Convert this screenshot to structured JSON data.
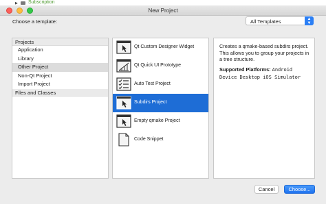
{
  "behind": {
    "label": "Subscription"
  },
  "window": {
    "title": "New Project"
  },
  "choose_label": "Choose a template:",
  "filter": {
    "selected": "All Templates"
  },
  "categories": {
    "projects_header": "Projects",
    "items": [
      "Application",
      "Library",
      "Other Project",
      "Non-Qt Project",
      "Import Project"
    ],
    "selected_index": 2,
    "files_header": "Files and Classes"
  },
  "templates": [
    {
      "label": "Qt Custom Designer Widget",
      "icon": "designer-widget-icon"
    },
    {
      "label": "Qt Quick UI Prototype",
      "icon": "qtquick-icon"
    },
    {
      "label": "Auto Test Project",
      "icon": "checklist-icon"
    },
    {
      "label": "Subdirs Project",
      "icon": "window-cursor-icon"
    },
    {
      "label": "Empty qmake Project",
      "icon": "window-cursor-icon"
    },
    {
      "label": "Code Snippet",
      "icon": "document-icon"
    }
  ],
  "selected_template_index": 3,
  "description": {
    "text": "Creates a qmake-based subdirs project. This allows you to group your projects in a tree structure.",
    "platforms_label": "Supported Platforms:",
    "platforms_value": "Android Device Desktop iOS Simulator"
  },
  "buttons": {
    "cancel": "Cancel",
    "choose": "Choose..."
  },
  "colors": {
    "accent": "#1e6dd6",
    "behind_label": "#4d9a2f"
  }
}
